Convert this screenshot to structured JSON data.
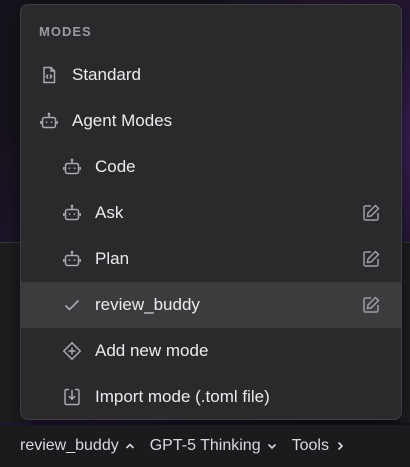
{
  "menu": {
    "header": "MODES",
    "items": [
      {
        "label": "Standard",
        "icon": "file-code-icon"
      },
      {
        "label": "Agent Modes",
        "icon": "robot-icon"
      },
      {
        "label": "Code",
        "icon": "robot-icon"
      },
      {
        "label": "Ask",
        "icon": "robot-icon",
        "editable": true
      },
      {
        "label": "Plan",
        "icon": "robot-icon",
        "editable": true
      },
      {
        "label": "review_buddy",
        "icon": "check-icon",
        "editable": true,
        "selected": true
      },
      {
        "label": "Add new mode",
        "icon": "plus-circle-icon"
      },
      {
        "label": "Import mode (.toml file)",
        "icon": "import-icon"
      }
    ]
  },
  "bottombar": {
    "mode_label": "review_buddy",
    "model_label": "GPT-5 Thinking",
    "tools_label": "Tools"
  },
  "colors": {
    "menu_bg": "#2a2a2d",
    "selected_bg": "#3b3c3e",
    "text": "#ececef",
    "muted": "#9a9aa0"
  }
}
